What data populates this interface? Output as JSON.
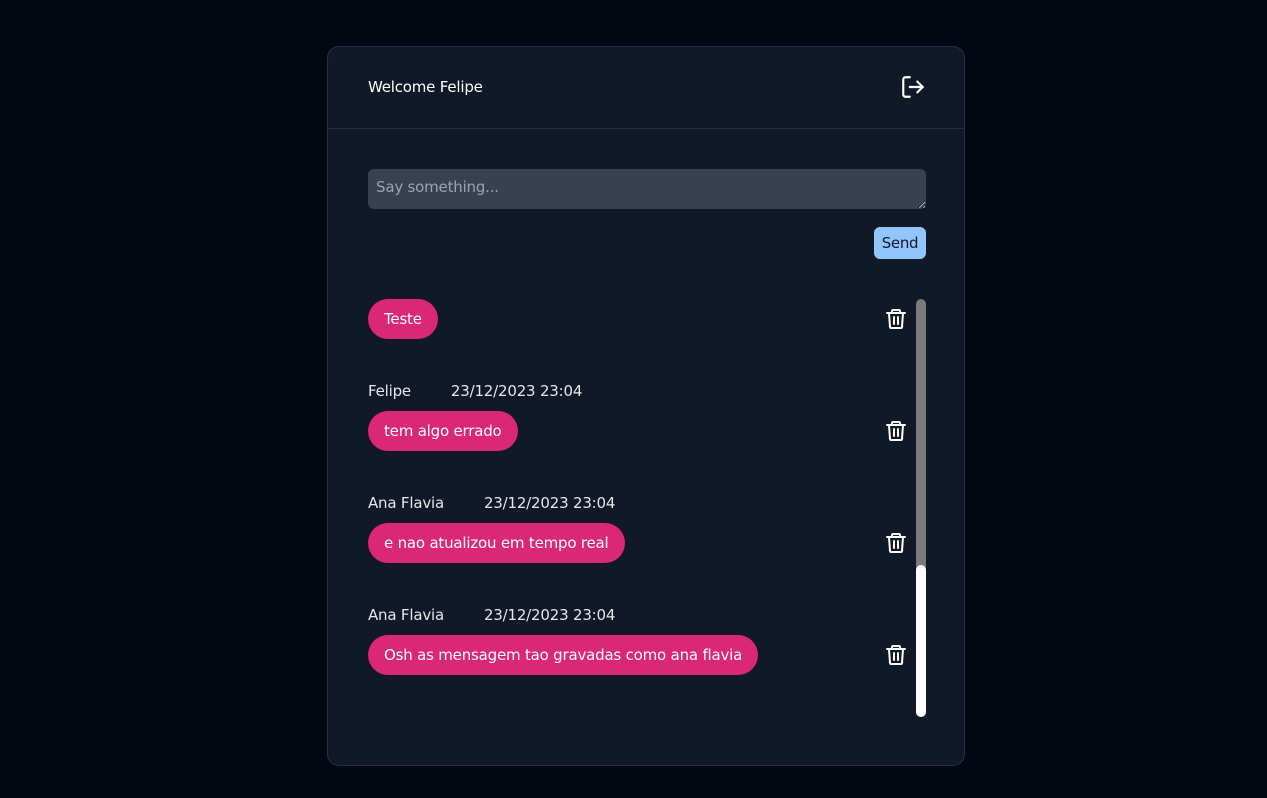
{
  "header": {
    "welcome_text": "Welcome Felipe",
    "logout_icon": "logout-icon"
  },
  "composer": {
    "placeholder": "Say something...",
    "value": "",
    "send_label": "Send",
    "send_color": "#93c5fd"
  },
  "colors": {
    "background": "#030712",
    "card": "#111827",
    "bubble": "#db2777"
  },
  "messages": [
    {
      "author": "",
      "timestamp": "",
      "text": "Teste",
      "delete_icon": "trash-icon"
    },
    {
      "author": "Felipe",
      "timestamp": "23/12/2023 23:04",
      "text": "tem algo errado",
      "delete_icon": "trash-icon"
    },
    {
      "author": "Ana Flavia",
      "timestamp": "23/12/2023 23:04",
      "text": "e nao atualizou em tempo real",
      "delete_icon": "trash-icon"
    },
    {
      "author": "Ana Flavia",
      "timestamp": "23/12/2023 23:04",
      "text": "Osh as mensagem tao gravadas como ana flavia",
      "delete_icon": "trash-icon"
    }
  ],
  "scrollbar": {
    "scroll_position": 1.0
  }
}
